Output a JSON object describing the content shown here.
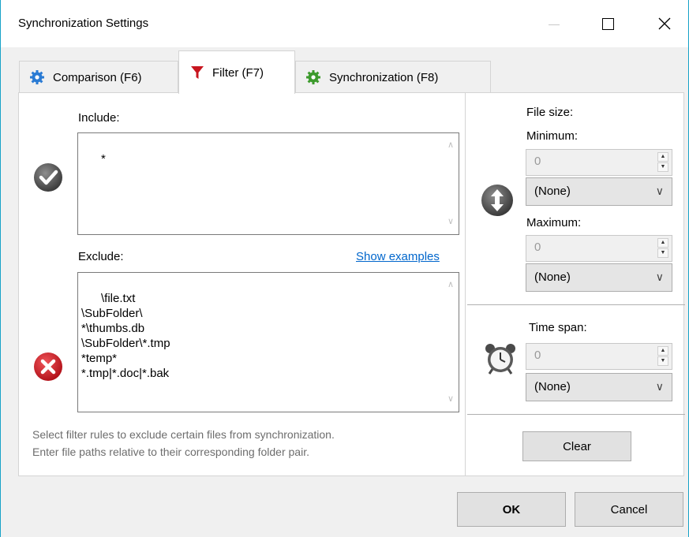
{
  "window": {
    "title": "Synchronization Settings"
  },
  "tabs": [
    {
      "label": "Comparison (F6)",
      "icon": "gear-icon-blue"
    },
    {
      "label": "Filter (F7)",
      "icon": "funnel-icon-red"
    },
    {
      "label": "Synchronization (F8)",
      "icon": "gear-icon-green"
    }
  ],
  "filter": {
    "include_label": "Include:",
    "include_value": "*",
    "exclude_label": "Exclude:",
    "show_examples": "Show examples",
    "exclude_value": "\\file.txt\n\\SubFolder\\\n*\\thumbs.db\n\\SubFolder\\*.tmp\n*temp*\n*.tmp|*.doc|*.bak",
    "hint_line1": "Select filter rules to exclude certain files from synchronization.",
    "hint_line2": "Enter file paths relative to their corresponding folder pair."
  },
  "file_size": {
    "label": "File size:",
    "minimum_label": "Minimum:",
    "minimum_value": "0",
    "minimum_unit": "(None)",
    "maximum_label": "Maximum:",
    "maximum_value": "0",
    "maximum_unit": "(None)"
  },
  "time_span": {
    "label": "Time span:",
    "value": "0",
    "unit": "(None)"
  },
  "buttons": {
    "clear": "Clear",
    "ok": "OK",
    "cancel": "Cancel"
  },
  "colors": {
    "link": "#0066cc",
    "window_border": "#17a2c8",
    "exclude_icon": "#d9252b",
    "funnel": "#c8151f"
  }
}
